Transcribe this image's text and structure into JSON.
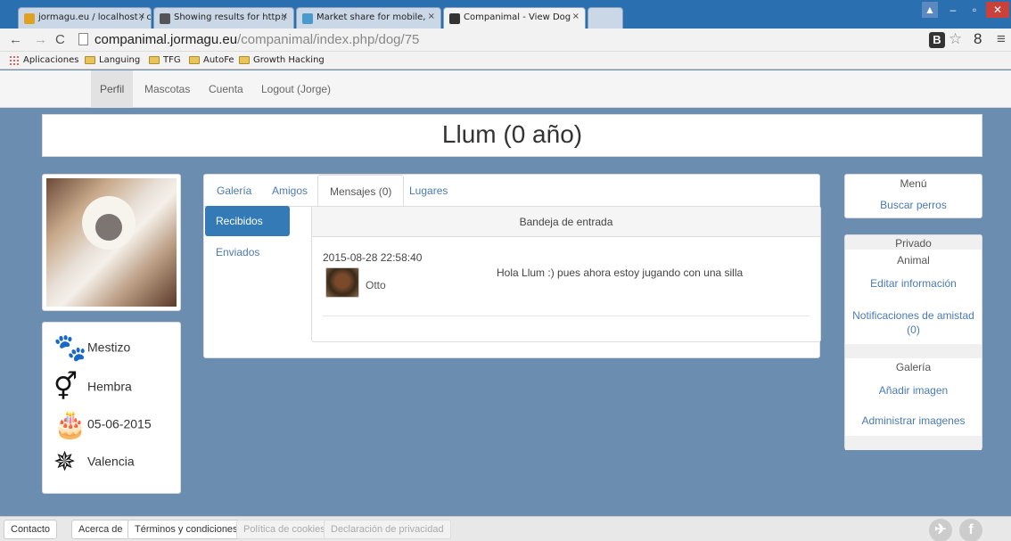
{
  "browser": {
    "tabs": [
      {
        "title": "jormagu.eu / localhost / c"
      },
      {
        "title": "Showing results for http:/"
      },
      {
        "title": "Market share for mobile, "
      },
      {
        "title": "Companimal - View Dog"
      }
    ],
    "close_glyph": "×",
    "url_host": "companimal.jormagu.eu",
    "url_path": "/companimal/index.php/dog/75",
    "bookmarks": [
      "Aplicaciones",
      "Languing",
      "TFG",
      "AutoFe",
      "Growth Hacking"
    ],
    "ext_b": "B"
  },
  "nav": {
    "items": [
      "Perfil",
      "Mascotas",
      "Cuenta",
      "Logout (Jorge)"
    ]
  },
  "page": {
    "title": "Llum (0 año)"
  },
  "dog": {
    "breed": "Mestizo",
    "sex": "Hembra",
    "birthdate": "05-06-2015",
    "location": "Valencia"
  },
  "tabs": {
    "items": [
      "Galería",
      "Amigos",
      "Mensajes (0)",
      "Lugares"
    ],
    "active": "Mensajes (0)"
  },
  "messages": {
    "received_label": "Recibidos",
    "sent_label": "Enviados",
    "inbox_title": "Bandeja de entrada",
    "items": [
      {
        "date": "2015-08-28 22:58:40",
        "sender": "Otto",
        "text": "Hola Llum :) pues ahora estoy jugando con una silla"
      }
    ]
  },
  "sidebar": {
    "menu_title": "Menú",
    "search_dogs": "Buscar perros",
    "private_title": "Privado",
    "animal_title": "Animal",
    "edit_info": "Editar información",
    "friend_notifications": "Notificaciones de amistad (0)",
    "gallery_title": "Galería",
    "add_image": "Añadir imagen",
    "manage_images": "Administrar imagenes"
  },
  "footer": {
    "buttons": [
      "Contacto",
      "Acerca de",
      "Términos y condiciones",
      "Política de cookies",
      "Declaración de privacidad"
    ],
    "social": [
      "twitter-icon",
      "facebook-icon"
    ],
    "facebook_glyph": "f"
  },
  "colors": {
    "page_bg": "#6b8db0",
    "link": "#4a7ab5",
    "primary": "#337ab7"
  }
}
